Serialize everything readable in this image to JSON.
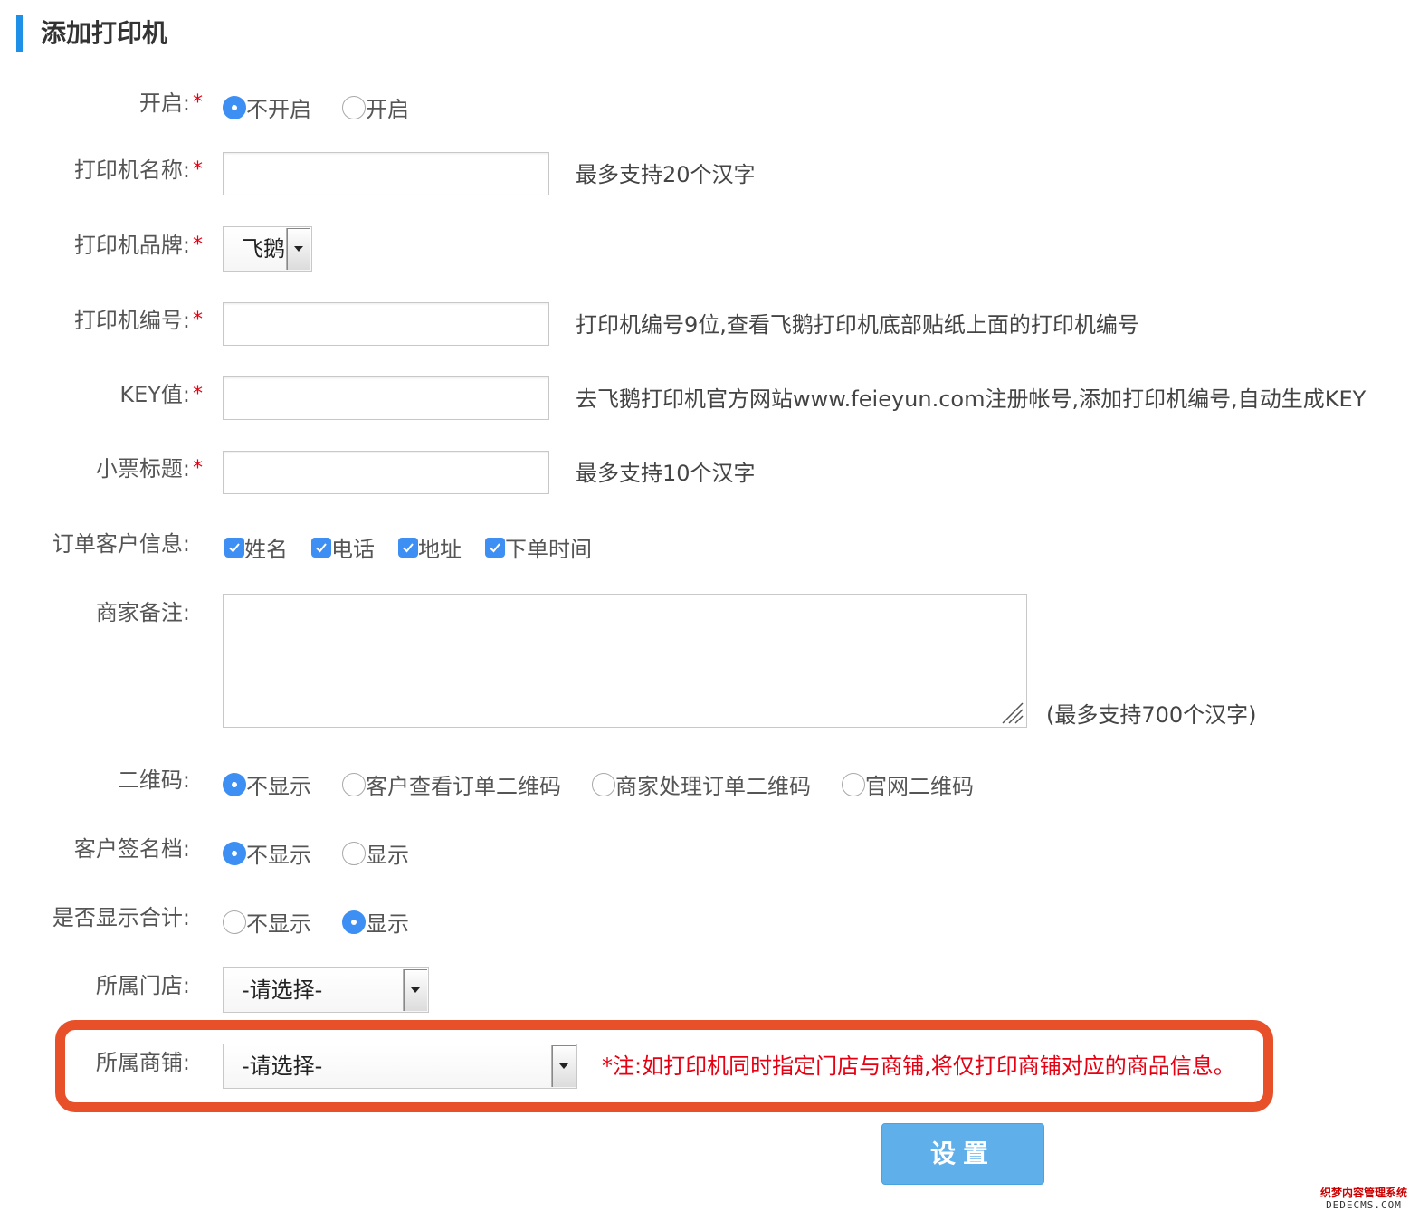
{
  "page": {
    "title": "添加打印机"
  },
  "required_mark": "*",
  "fields": {
    "enable": {
      "label": "开启:",
      "options": [
        "不开启",
        "开启"
      ],
      "selected": "不开启"
    },
    "printer_name": {
      "label": "打印机名称:",
      "value": "",
      "hint": "最多支持20个汉字"
    },
    "printer_brand": {
      "label": "打印机品牌:",
      "selected": "飞鹅"
    },
    "printer_number": {
      "label": "打印机编号:",
      "value": "",
      "hint": "打印机编号9位,查看飞鹅打印机底部贴纸上面的打印机编号"
    },
    "key": {
      "label": "KEY值:",
      "value": "",
      "hint": "去飞鹅打印机官方网站www.feieyun.com注册帐号,添加打印机编号,自动生成KEY"
    },
    "receipt_title": {
      "label": "小票标题:",
      "value": "",
      "hint": "最多支持10个汉字"
    },
    "customer_info": {
      "label": "订单客户信息:",
      "options": [
        "姓名",
        "电话",
        "地址",
        "下单时间"
      ],
      "checked": [
        "姓名",
        "电话",
        "地址",
        "下单时间"
      ]
    },
    "merchant_note": {
      "label": "商家备注:",
      "value": "",
      "hint": "(最多支持700个汉字)"
    },
    "qrcode": {
      "label": "二维码:",
      "options": [
        "不显示",
        "客户查看订单二维码",
        "商家处理订单二维码",
        "官网二维码"
      ],
      "selected": "不显示"
    },
    "signature": {
      "label": "客户签名档:",
      "options": [
        "不显示",
        "显示"
      ],
      "selected": "不显示"
    },
    "show_total": {
      "label": "是否显示合计:",
      "options": [
        "不显示",
        "显示"
      ],
      "selected": "显示"
    },
    "store": {
      "label": "所属门店:",
      "selected": "-请选择-"
    },
    "shop": {
      "label": "所属商铺:",
      "selected": "-请选择-",
      "note": "*注:如打印机同时指定门店与商铺,将仅打印商铺对应的商品信息。"
    }
  },
  "submit_label": "设置",
  "watermark": {
    "line1": "织梦内容管理系统",
    "line2": "DEDECMS.COM"
  },
  "colors": {
    "accent": "#3d8ff3",
    "required": "#e60012",
    "highlight": "#e8502a",
    "button": "#5fb0ea"
  }
}
